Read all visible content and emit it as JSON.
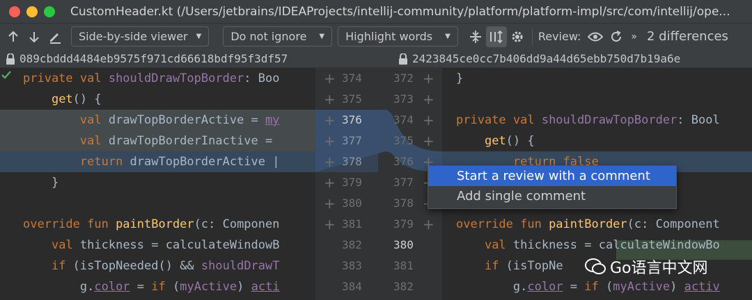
{
  "window": {
    "title": "CustomHeader.kt (/Users/jetbrains/IDEAProjects/intellij-community/platform/platform-impl/src/com/intellij/ope...",
    "traffic_lights": {
      "close": "#fe5f57",
      "minimize": "#febc2e",
      "maximize": "#28c840"
    }
  },
  "toolbar": {
    "prev_icon": "arrow-up-icon",
    "next_icon": "arrow-down-icon",
    "edit_icon": "pencil-icon",
    "viewer_mode": "Side-by-side viewer",
    "whitespace_mode": "Do not ignore",
    "highlight_mode": "Highlight words",
    "collapse_icon": "collapse-unchanged-icon",
    "sync_scroll_icon": "sync-scroll-icon",
    "settings_icon": "gear-icon",
    "review_label": "Review:",
    "eye_icon": "eye-icon",
    "refresh_icon": "refresh-icon",
    "more_label": "»",
    "differences_label": "2 differences"
  },
  "revisions": {
    "left_hash": "089cbddd4484eb9575f971cd66618bdf95f3df57",
    "right_hash": "2423845ce0cc7b406dd9a44d65ebb750d7b19a6e"
  },
  "left_code": {
    "lines": [
      [
        {
          "t": "private val ",
          "c": "kw"
        },
        {
          "t": "shouldDrawTopBorder",
          "c": "pr"
        },
        {
          "t": ": Boo",
          "c": "tx"
        }
      ],
      [
        {
          "t": "    ",
          "c": "tx"
        },
        {
          "t": "get",
          "c": "fn"
        },
        {
          "t": "() {",
          "c": "tx"
        }
      ],
      [
        {
          "t": "        ",
          "c": "tx"
        },
        {
          "t": "val ",
          "c": "kw"
        },
        {
          "t": "drawTopBorderActive = ",
          "c": "tx"
        },
        {
          "t": "my",
          "c": "pr ul"
        }
      ],
      [
        {
          "t": "        ",
          "c": "tx"
        },
        {
          "t": "val ",
          "c": "kw"
        },
        {
          "t": "drawTopBorderInactive = ",
          "c": "tx"
        }
      ],
      [
        {
          "t": "        ",
          "c": "tx"
        },
        {
          "t": "return ",
          "c": "kw"
        },
        {
          "t": "drawTopBorderActive |",
          "c": "tx"
        }
      ],
      [
        {
          "t": "    }",
          "c": "tx"
        }
      ],
      [
        {
          "t": "",
          "c": "tx"
        }
      ],
      [
        {
          "t": "override fun ",
          "c": "kw"
        },
        {
          "t": "paintBorder",
          "c": "fn"
        },
        {
          "t": "(c: Componen",
          "c": "tx"
        }
      ],
      [
        {
          "t": "    ",
          "c": "tx"
        },
        {
          "t": "val ",
          "c": "kw"
        },
        {
          "t": "thickness = calculateWindowB",
          "c": "tx"
        }
      ],
      [
        {
          "t": "    ",
          "c": "tx"
        },
        {
          "t": "if ",
          "c": "kw"
        },
        {
          "t": "(isTopNeeded() && ",
          "c": "tx"
        },
        {
          "t": "shouldDrawT",
          "c": "pr"
        }
      ],
      [
        {
          "t": "        g.",
          "c": "tx"
        },
        {
          "t": "color",
          "c": "pr ul"
        },
        {
          "t": " = ",
          "c": "tx"
        },
        {
          "t": "if ",
          "c": "kw"
        },
        {
          "t": "(",
          "c": "tx"
        },
        {
          "t": "myActive",
          "c": "pr"
        },
        {
          "t": ") ",
          "c": "tx"
        },
        {
          "t": "acti",
          "c": "pr ul"
        }
      ]
    ]
  },
  "right_code": {
    "lines": [
      [
        {
          "t": "}",
          "c": "tx"
        }
      ],
      [
        {
          "t": "",
          "c": "tx"
        }
      ],
      [
        {
          "t": "private val ",
          "c": "kw"
        },
        {
          "t": "shouldDrawTopBorder",
          "c": "pr"
        },
        {
          "t": ": Bool",
          "c": "tx"
        }
      ],
      [
        {
          "t": "    ",
          "c": "tx"
        },
        {
          "t": "get",
          "c": "fn"
        },
        {
          "t": "() {",
          "c": "tx"
        }
      ],
      [
        {
          "t": "        ",
          "c": "tx"
        },
        {
          "t": "return false",
          "c": "kw"
        }
      ],
      [
        {
          "t": "",
          "c": "tx"
        }
      ],
      [
        {
          "t": "",
          "c": "tx"
        }
      ],
      [
        {
          "t": "override fun ",
          "c": "kw"
        },
        {
          "t": "paintBorder",
          "c": "fn"
        },
        {
          "t": "(c: Component",
          "c": "tx"
        }
      ],
      [
        {
          "t": "    ",
          "c": "tx"
        },
        {
          "t": "val ",
          "c": "kw"
        },
        {
          "t": "thickness = calculateWindowBo",
          "c": "tx"
        }
      ],
      [
        {
          "t": "    ",
          "c": "tx"
        },
        {
          "t": "if ",
          "c": "kw"
        },
        {
          "t": "(isTopNe",
          "c": "tx"
        }
      ],
      [
        {
          "t": "        g.",
          "c": "tx"
        },
        {
          "t": "color",
          "c": "pr ul"
        },
        {
          "t": " = ",
          "c": "tx"
        },
        {
          "t": "if ",
          "c": "kw"
        },
        {
          "t": "(",
          "c": "tx"
        },
        {
          "t": "myActive",
          "c": "pr"
        },
        {
          "t": ") ",
          "c": "tx"
        },
        {
          "t": "activ",
          "c": "pr ul"
        }
      ]
    ]
  },
  "gutter": {
    "left_numbers": [
      "374",
      "375",
      "376",
      "377",
      "378",
      "379",
      "380",
      "381",
      "382",
      "383",
      "384"
    ],
    "right_numbers": [
      "372",
      "373",
      "374",
      "375",
      "376",
      "377",
      "378",
      "379",
      "380",
      "381",
      "382"
    ]
  },
  "popup": {
    "items": [
      "Start a review with a comment",
      "Add single comment"
    ]
  },
  "watermark": {
    "text": "Go语言中文网"
  },
  "colors": {
    "keyword": "#cc7832",
    "function": "#ffc66d",
    "property": "#9876aa",
    "text": "#a9b7c6",
    "changed_bg": "#454a4d",
    "selection_bg": "#36485c",
    "popup_selected": "#2f65ca"
  }
}
